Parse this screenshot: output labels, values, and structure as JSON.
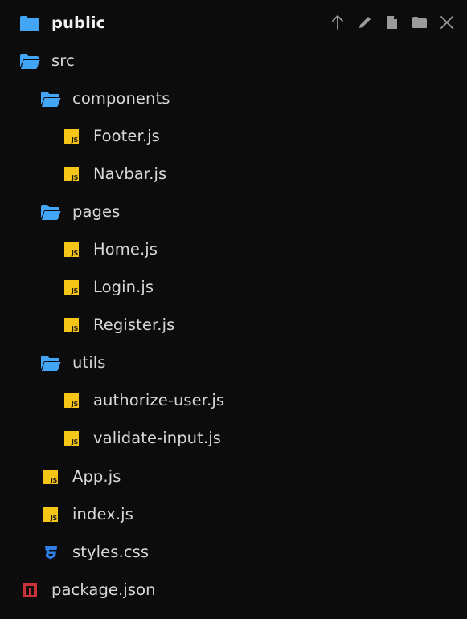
{
  "colors": {
    "background": "#0c0c0d",
    "folder_blue": "#42a5f5",
    "js_yellow": "#f5c518",
    "css_blue": "#2f7fe6",
    "npm_red": "#c9313b",
    "text": "#d8d8d8",
    "toolbar_icon": "#9a9a9a"
  },
  "toolbar": {
    "icons": [
      "arrow-up-icon",
      "pencil-icon",
      "new-file-icon",
      "new-folder-icon",
      "close-icon"
    ]
  },
  "tree": {
    "public": {
      "label": "public",
      "icon": "folder-closed-icon"
    },
    "src": {
      "label": "src",
      "icon": "folder-open-icon"
    },
    "components": {
      "label": "components",
      "icon": "folder-open-icon"
    },
    "footer": {
      "label": "Footer.js",
      "icon": "js-file-icon",
      "badge": "JS"
    },
    "navbar": {
      "label": "Navbar.js",
      "icon": "js-file-icon",
      "badge": "JS"
    },
    "pages": {
      "label": "pages",
      "icon": "folder-open-icon"
    },
    "home": {
      "label": "Home.js",
      "icon": "js-file-icon",
      "badge": "JS"
    },
    "login": {
      "label": "Login.js",
      "icon": "js-file-icon",
      "badge": "JS"
    },
    "register": {
      "label": "Register.js",
      "icon": "js-file-icon",
      "badge": "JS"
    },
    "utils": {
      "label": "utils",
      "icon": "folder-open-icon"
    },
    "authorize_user": {
      "label": "authorize-user.js",
      "icon": "js-file-icon",
      "badge": "JS"
    },
    "validate_input": {
      "label": "validate-input.js",
      "icon": "js-file-icon",
      "badge": "JS"
    },
    "app": {
      "label": "App.js",
      "icon": "js-file-icon",
      "badge": "JS"
    },
    "index": {
      "label": "index.js",
      "icon": "js-file-icon",
      "badge": "JS"
    },
    "styles": {
      "label": "styles.css",
      "icon": "css-file-icon"
    },
    "package": {
      "label": "package.json",
      "icon": "npm-icon"
    }
  }
}
